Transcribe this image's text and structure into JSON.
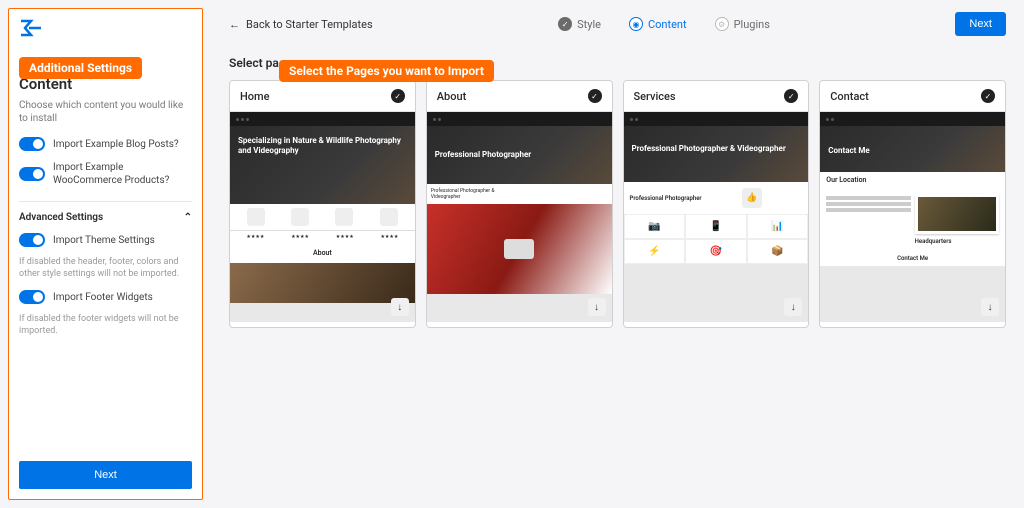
{
  "callouts": {
    "additional_settings": "Additional Settings",
    "select_pages_import": "Select the Pages you want to Import"
  },
  "topbar": {
    "back_label": "Back to Starter Templates",
    "next_label": "Next"
  },
  "steps": {
    "style": {
      "label": "Style",
      "status": "done"
    },
    "content": {
      "label": "Content",
      "status": "current"
    },
    "plugins": {
      "label": "Plugins",
      "status": "pending"
    }
  },
  "sidebar": {
    "title": "Content",
    "description": "Choose which content you would like to install",
    "toggle_blog": "Import Example Blog Posts?",
    "toggle_woo": "Import Example WooCommerce Products?",
    "advanced_label": "Advanced Settings",
    "toggle_theme": "Import Theme Settings",
    "theme_desc": "If disabled the header, footer, colors and other style settings will not be imported.",
    "toggle_footer": "Import Footer Widgets",
    "footer_desc": "If disabled the footer widgets will not be imported.",
    "next_label": "Next"
  },
  "main": {
    "select_pages_label": "Select pages"
  },
  "pages": [
    {
      "name": "Home",
      "selected": true,
      "hero_title": "Specializing in Nature & Wildlife Photography and Videography",
      "section_title": "About"
    },
    {
      "name": "About",
      "selected": true,
      "hero_title": "Professional Photographer",
      "section_title": "Professional Photographer & Videographer"
    },
    {
      "name": "Services",
      "selected": true,
      "hero_title": "Professional Photographer & Videographer",
      "section_title": "Professional Photographer"
    },
    {
      "name": "Contact",
      "selected": true,
      "hero_title": "Contact Me",
      "section_title": "Our Location",
      "section_title_2": "Headquarters",
      "section_title_3": "Contact Me"
    }
  ],
  "colors": {
    "accent": "#0073e6",
    "highlight": "#ff6b00"
  }
}
